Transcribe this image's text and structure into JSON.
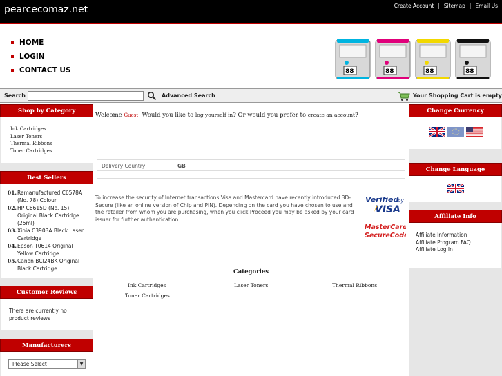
{
  "site": {
    "logo": "pearcecomaz.net"
  },
  "top_links": [
    "Create Account",
    "Sitemap",
    "Email Us"
  ],
  "nav": [
    "HOME",
    "LOGIN",
    "CONTACT US"
  ],
  "cartridge_label": "88",
  "search": {
    "label": "Search",
    "value": "",
    "advanced": "Advanced Search"
  },
  "cart": {
    "text": "Your Shopping Cart is empty"
  },
  "left": {
    "category_title": "Shop by Category",
    "categories": [
      "Ink Cartridges",
      "Laser Toners",
      "Thermal Ribbons",
      "Toner Cartridges"
    ],
    "best_title": "Best Sellers",
    "best": [
      {
        "num": "01.",
        "label": "Remanufactured C6578A (No. 78) Colour"
      },
      {
        "num": "02.",
        "label": "HP C6615D (No. 15) Original Black Cartridge (25ml)"
      },
      {
        "num": "03.",
        "label": "Xinia C3903A Black Laser Cartridge"
      },
      {
        "num": "04.",
        "label": "Epson T0614 Original Yellow Cartridge"
      },
      {
        "num": "05.",
        "label": "Canon BCI24BK Original Black Cartridge"
      }
    ],
    "reviews_title": "Customer Reviews",
    "reviews_text": "There are currently no product reviews",
    "manufacturers_title": "Manufacturers",
    "manufacturers_selected": "Please Select"
  },
  "main": {
    "welcome_pre": "Welcome ",
    "guest": "Guest!",
    "welcome_mid": " Would you like to ",
    "login_link": "log yourself in",
    "welcome_mid2": "? Or would you prefer to ",
    "create_link": "create an account",
    "welcome_end": "?",
    "delivery_label": "Delivery Country",
    "delivery_value": "GB",
    "security_text": "To increase the security of Internet transactions Visa and Mastercard have recently introduced 3D-Secure (like an online version of Chip and PIN). Depending on the card you have chosen to use and the retailer from whom you are purchasing, when you click Proceed you may be asked by your card issuer for further authentication.",
    "visa_top": "Verified",
    "visa_by": "by",
    "visa_word": "VISA",
    "mc_top": "MasterCard.",
    "mc_bottom": "SecureCode.",
    "categories_title": "Categories",
    "categories": [
      "Ink Cartridges",
      "Laser Toners",
      "Thermal Ribbons",
      "Toner Cartridges"
    ]
  },
  "right": {
    "currency_title": "Change Currency",
    "language_title": "Change Language",
    "affiliate_title": "Affiliate Info",
    "affiliate_links": [
      "Affiliate Information",
      "Affiliate Program FAQ",
      "Affiliate Log In"
    ]
  },
  "colors": {
    "accent": "#c00000",
    "topbar": "#000000",
    "sidebar_bg": "#e6e6e6"
  }
}
